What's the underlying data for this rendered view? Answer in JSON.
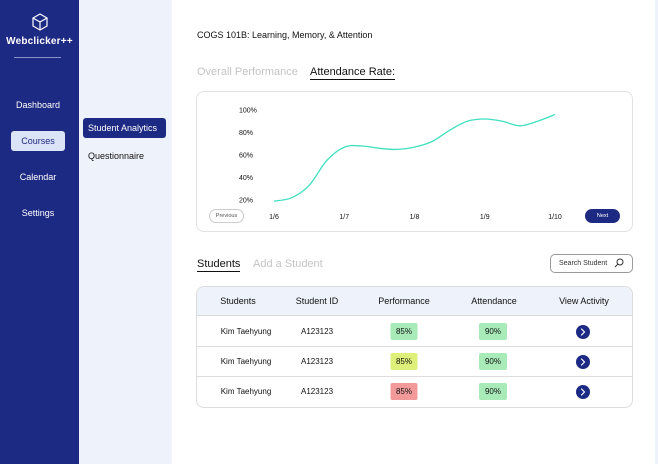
{
  "brand": {
    "name": "Webclicker++",
    "logo_icon": "cube-icon"
  },
  "nav": {
    "items": [
      {
        "label": "Dashboard",
        "active": false
      },
      {
        "label": "Courses",
        "active": true
      },
      {
        "label": "Calendar",
        "active": false
      },
      {
        "label": "Settings",
        "active": false
      }
    ]
  },
  "subnav": {
    "items": [
      {
        "label": "Student Analytics",
        "active": true
      },
      {
        "label": "Questionnaire",
        "active": false
      }
    ]
  },
  "course": {
    "title": "COGS 101B: Learning, Memory, & Attention"
  },
  "chart_tabs": [
    {
      "label": "Overall Performance",
      "active": false
    },
    {
      "label": "Attendance Rate:",
      "active": true
    }
  ],
  "chart_data": {
    "type": "line",
    "title": "",
    "xlabel": "",
    "ylabel": "",
    "x_ticks": [
      "1/6",
      "1/7",
      "1/8",
      "1/9",
      "1/10"
    ],
    "y_ticks": [
      "20%",
      "40%",
      "60%",
      "80%",
      "100%"
    ],
    "ylim": [
      20,
      100
    ],
    "grid": false,
    "color": "#3fe0c0",
    "series": [
      {
        "x": [
          0.0,
          0.25,
          0.5,
          0.75,
          1.0,
          1.25,
          1.5,
          1.75,
          2.0,
          2.25,
          2.5,
          2.75,
          3.0,
          3.25,
          3.5,
          3.75,
          4.0
        ],
        "values": [
          19,
          22,
          33,
          55,
          67,
          68,
          66,
          65,
          67,
          72,
          82,
          90,
          92,
          90,
          86,
          90,
          96
        ]
      }
    ]
  },
  "chart_controls": {
    "prev_label": "Previous",
    "next_label": "Next"
  },
  "section_tabs": [
    {
      "label": "Students",
      "active": true
    },
    {
      "label": "Add a Student",
      "active": false
    }
  ],
  "search": {
    "placeholder": "Search Student",
    "icon": "search-icon"
  },
  "table": {
    "headers": [
      "Students",
      "Student ID",
      "Performance",
      "Attendance",
      "View Activity"
    ],
    "rows": [
      {
        "name": "Kim Taehyung",
        "id": "A123123",
        "performance": "85%",
        "performance_color": "#a8eab8",
        "attendance": "90%",
        "attendance_color": "#a8eab8"
      },
      {
        "name": "Kim Taehyung",
        "id": "A123123",
        "performance": "85%",
        "performance_color": "#dff07a",
        "attendance": "90%",
        "attendance_color": "#a8eab8"
      },
      {
        "name": "Kim Taehyung",
        "id": "A123123",
        "performance": "85%",
        "performance_color": "#f29a9a",
        "attendance": "90%",
        "attendance_color": "#a8eab8"
      }
    ]
  },
  "colors": {
    "primary": "#1d2a83",
    "light": "#eef2fb",
    "line": "#3fe0c0"
  }
}
